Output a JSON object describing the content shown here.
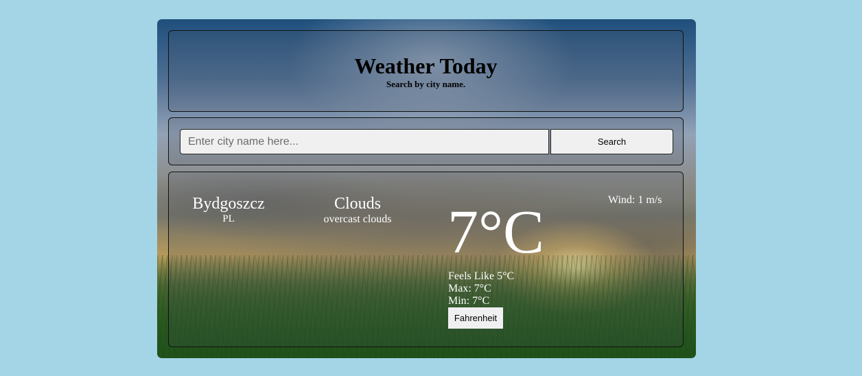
{
  "header": {
    "title": "Weather Today",
    "subtitle": "Search by city name."
  },
  "search": {
    "placeholder": "Enter city name here...",
    "value": "",
    "button_label": "Search"
  },
  "weather": {
    "city": "Bydgoszcz",
    "country": "PL",
    "condition": "Clouds",
    "description": "overcast clouds",
    "temperature": "7°C",
    "feels_like": "Feels Like 5°C",
    "max": "Max: 7°C",
    "min": "Min: 7°C",
    "unit_toggle_label": "Fahrenheit",
    "wind": "Wind: 1 m/s"
  },
  "colors": {
    "page_background": "#a3d5e6",
    "text_light": "#ffffff",
    "control_background": "#f0f0f0"
  }
}
